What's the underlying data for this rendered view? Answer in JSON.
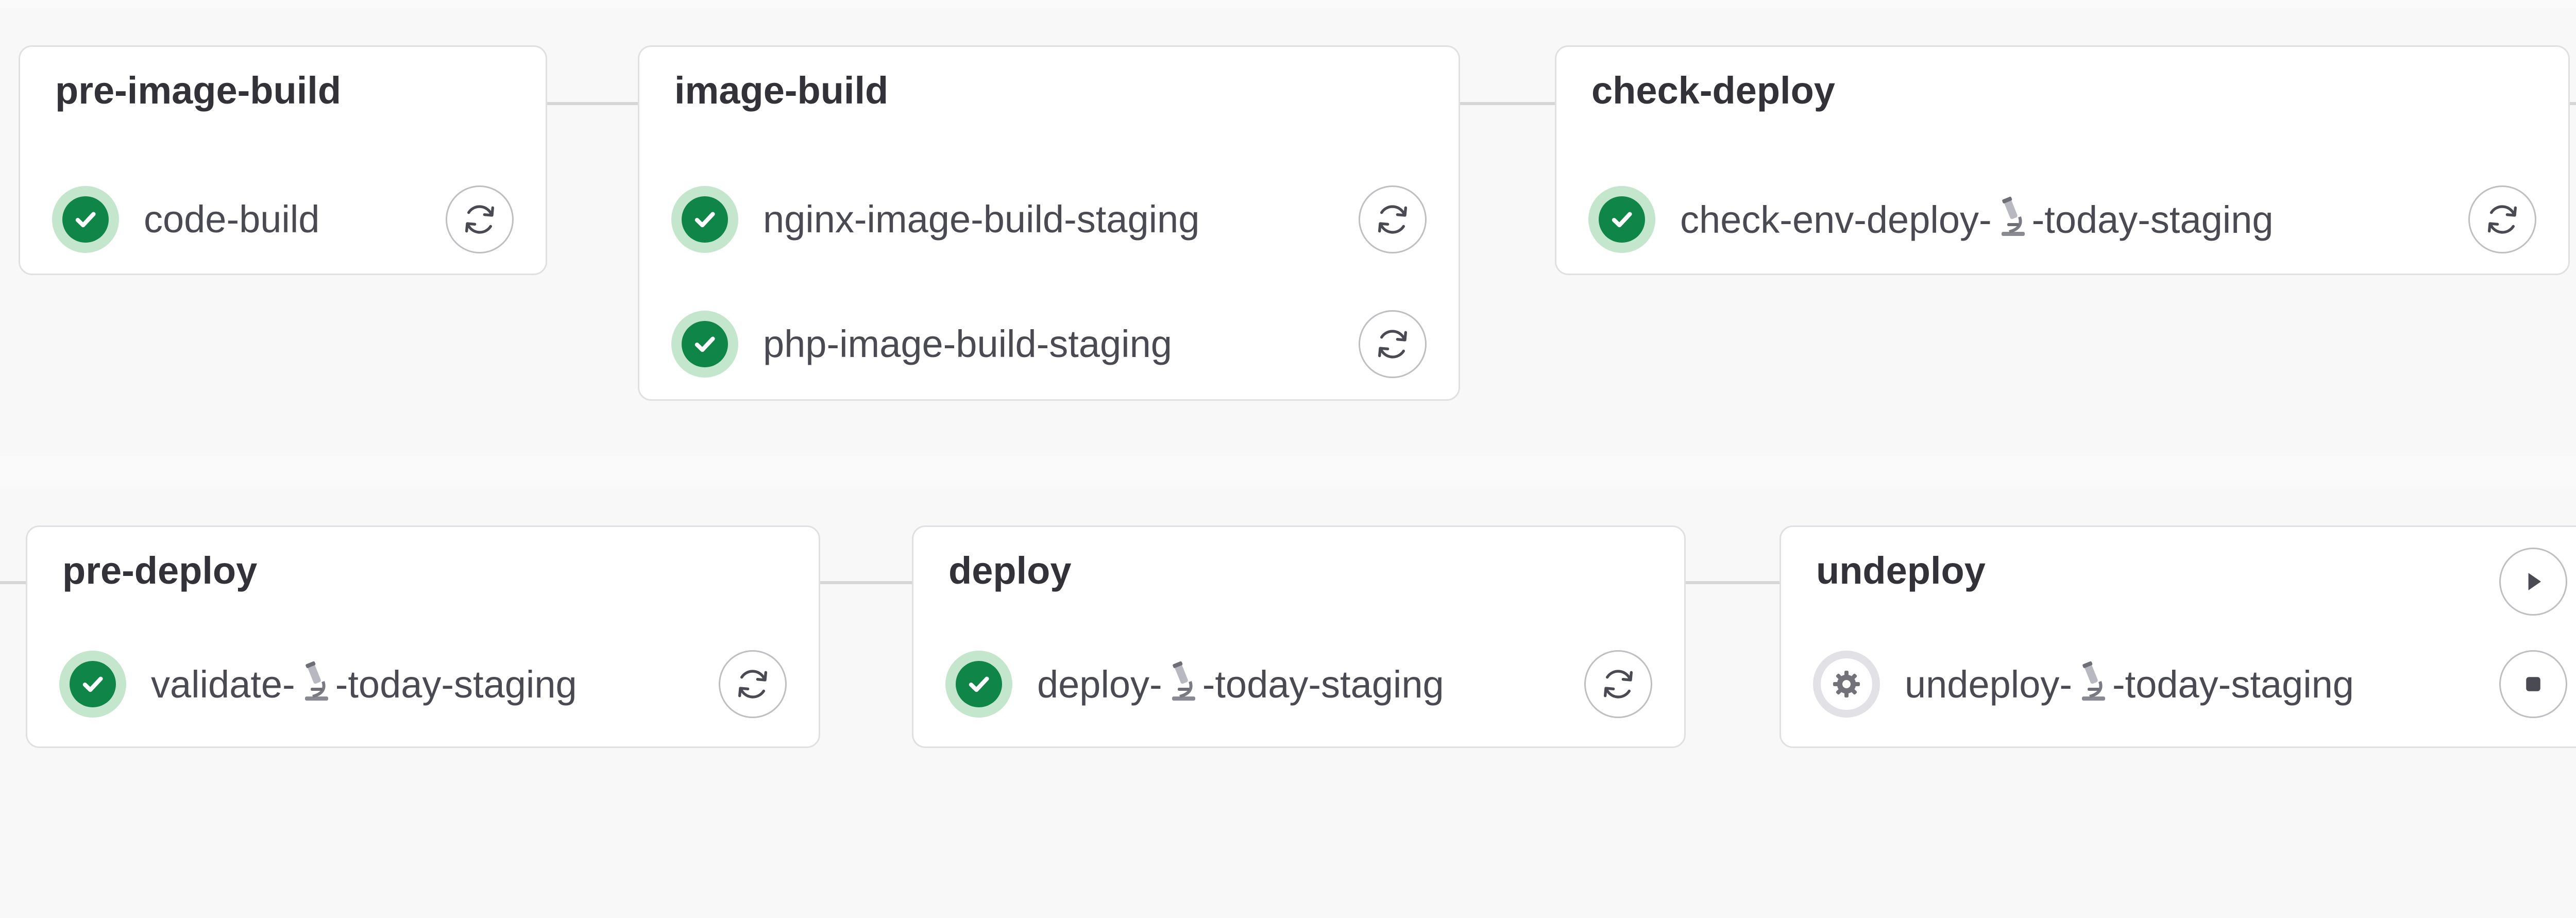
{
  "colors": {
    "success": "#108548",
    "success_ring": "#c3e6cd",
    "border": "#e0e0e4",
    "connector": "#d6d6d6",
    "text": "#333238"
  },
  "top_row": {
    "stages": [
      {
        "title": "pre-image-build",
        "jobs": [
          {
            "name": "code-build",
            "status": "success",
            "action": "retry-icon"
          }
        ]
      },
      {
        "title": "image-build",
        "jobs": [
          {
            "name": "nginx-image-build-staging",
            "status": "success",
            "action": "retry-icon"
          },
          {
            "name": "php-image-build-staging",
            "status": "success",
            "action": "retry-icon"
          }
        ]
      },
      {
        "title": "check-deploy",
        "jobs": [
          {
            "name_prefix": "check-env-deploy-",
            "name_icon": "microscope-emoji",
            "name_suffix": "-today-staging",
            "status": "success",
            "action": "retry-icon"
          }
        ]
      }
    ]
  },
  "bottom_row": {
    "stages": [
      {
        "title": "pre-deploy",
        "jobs": [
          {
            "name_prefix": "validate-",
            "name_icon": "microscope-emoji",
            "name_suffix": "-today-staging",
            "status": "success",
            "action": "retry-icon"
          }
        ]
      },
      {
        "title": "deploy",
        "jobs": [
          {
            "name_prefix": "deploy-",
            "name_icon": "microscope-emoji",
            "name_suffix": "-today-staging",
            "status": "success",
            "action": "retry-icon"
          }
        ]
      },
      {
        "title": "undeploy",
        "header_action": "play-icon",
        "jobs": [
          {
            "name_prefix": "undeploy-",
            "name_icon": "microscope-emoji",
            "name_suffix": "-today-staging",
            "status": "manual",
            "action": "stop-icon"
          }
        ]
      }
    ]
  }
}
